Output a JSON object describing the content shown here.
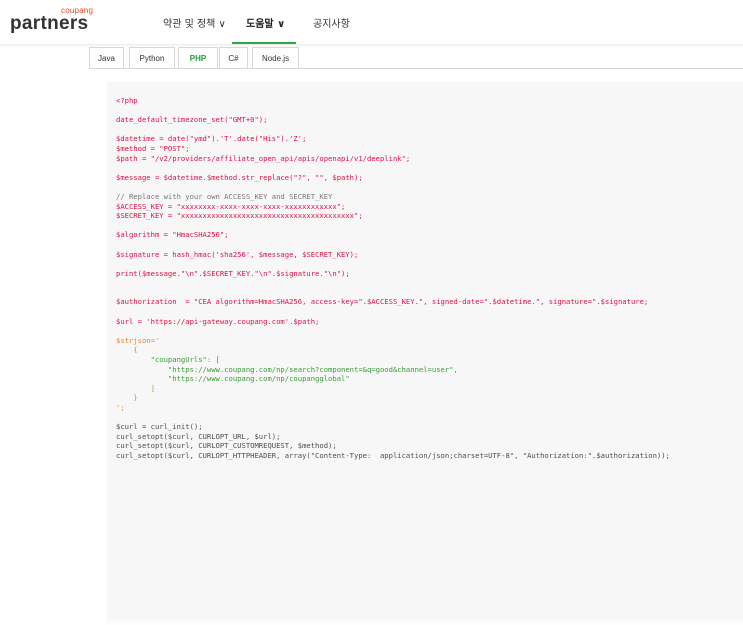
{
  "logo": {
    "small": "coupang",
    "big": "partners"
  },
  "nav": [
    {
      "label": "약관 및 정책 ∨"
    },
    {
      "label": "도움말 ∨"
    },
    {
      "label": "공지사항"
    }
  ],
  "tabs": [
    "Java",
    "Python",
    "PHP",
    "C#",
    "Node.js"
  ],
  "active_tab": "PHP",
  "colors": {
    "accent": "#27a844",
    "logo_orange": "#e8491d"
  },
  "code": {
    "open_tag": "<?php",
    "l1": "date_default_timezone_set(\"GMT+0\");",
    "l2": "$datetime = date(\"ymd\").'T'.date(\"His\").'Z';",
    "l3": "$method = \"POST\";",
    "l4": "$path = \"/v2/providers/affiliate_open_api/apis/openapi/v1/deeplink\";",
    "l5": "$message = $datetime.$method.str_replace(\"?\", \"\", $path);",
    "l6": "// Replace with your own ACCESS_KEY and SECRET_KEY",
    "l7": "$ACCESS_KEY = \"xxxxxxxx-xxxx-xxxx-xxxx-xxxxxxxxxxxx\";",
    "l8": "$SECRET_KEY = \"xxxxxxxxxxxxxxxxxxxxxxxxxxxxxxxxxxxxxxxx\";",
    "l9": "$algorithm = \"HmacSHA256\";",
    "l10": "$signature = hash_hmac('sha256', $message, $SECRET_KEY);",
    "l11": "print($message.\"\\n\".$SECRET_KEY.\"\\n\".$signature.\"\\n\");",
    "l12": "$authorization  = \"CEA algorithm=HmacSHA256, access-key=\".$ACCESS_KEY.\", signed-date=\".$datetime.\", signature=\".$signature;",
    "l13": "$url = 'https://api-gateway.coupang.com'.$path;",
    "l14": "$strjson='",
    "l15": "    {",
    "l16": "        \"coupangUrls\": [",
    "l17": "            \"https://www.coupang.com/np/search?component=&q=good&channel=user\",",
    "l18": "            \"https://www.coupang.com/np/coupangglobal\"",
    "l19": "        ]",
    "l20": "    }",
    "l21": "';",
    "l22": "$curl = curl_init();",
    "l23": "curl_setopt($curl, CURLOPT_URL, $url);",
    "l24": "curl_setopt($curl, CURLOPT_CUSTOMREQUEST, $method);",
    "l25": "curl_setopt($curl, CURLOPT_HTTPHEADER, array(\"Content-Type:  application/json;charset=UTF-8\", \"Authorization:\".$authorization));"
  }
}
